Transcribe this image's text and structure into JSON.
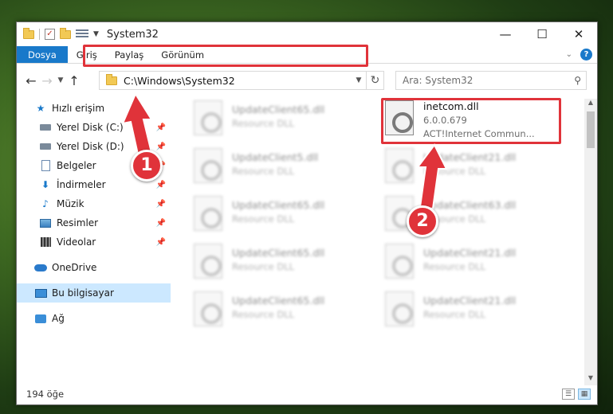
{
  "window": {
    "title": "System32",
    "controls": {
      "minimize": "—",
      "maximize": "☐",
      "close": "✕"
    }
  },
  "ribbon": {
    "tabs": [
      {
        "label": "Dosya",
        "active": true
      },
      {
        "label": "Giriş"
      },
      {
        "label": "Paylaş"
      },
      {
        "label": "Görünüm"
      }
    ],
    "help": "?"
  },
  "address": {
    "path": "C:\\Windows\\System32",
    "search_placeholder": "Ara: System32"
  },
  "sidebar": {
    "items": [
      {
        "label": "Hızlı erişim",
        "icon": "star-icon"
      },
      {
        "label": "Yerel Disk (C:)",
        "icon": "drive-icon",
        "pinned": true
      },
      {
        "label": "Yerel Disk (D:)",
        "icon": "drive-icon",
        "pinned": true
      },
      {
        "label": "Belgeler",
        "icon": "document-icon",
        "pinned": true
      },
      {
        "label": "İndirmeler",
        "icon": "download-icon",
        "pinned": true
      },
      {
        "label": "Müzik",
        "icon": "music-icon",
        "pinned": true
      },
      {
        "label": "Resimler",
        "icon": "pictures-icon",
        "pinned": true
      },
      {
        "label": "Videolar",
        "icon": "video-icon",
        "pinned": true
      },
      {
        "label": "OneDrive",
        "icon": "cloud-icon"
      },
      {
        "label": "Bu bilgisayar",
        "icon": "computer-icon",
        "selected": true
      },
      {
        "label": "Ağ",
        "icon": "network-icon"
      }
    ]
  },
  "files": [
    {
      "name": "UpdateClient65.dll",
      "type": "Resource DLL"
    },
    {
      "name": "inetcom.dll",
      "version": "6.0.0.679",
      "desc": "ACT!Internet Commun..."
    },
    {
      "name": "UpdateClient5.dll",
      "type": "Resource DLL"
    },
    {
      "name": "UpdateClient21.dll",
      "type": "Resource DLL"
    },
    {
      "name": "UpdateClient65.dll",
      "type": "Resource DLL"
    },
    {
      "name": "UpdateClient63.dll",
      "type": "Resource DLL"
    },
    {
      "name": "UpdateClient65.dll",
      "type": "Resource DLL"
    },
    {
      "name": "UpdateClient21.dll",
      "type": "Resource DLL"
    },
    {
      "name": "UpdateClient65.dll",
      "type": "Resource DLL"
    },
    {
      "name": "UpdateClient21.dll",
      "type": "Resource DLL"
    }
  ],
  "status": {
    "count": "194 öğe"
  },
  "annotations": {
    "step1": "1",
    "step2": "2",
    "color": "#e0333a"
  }
}
